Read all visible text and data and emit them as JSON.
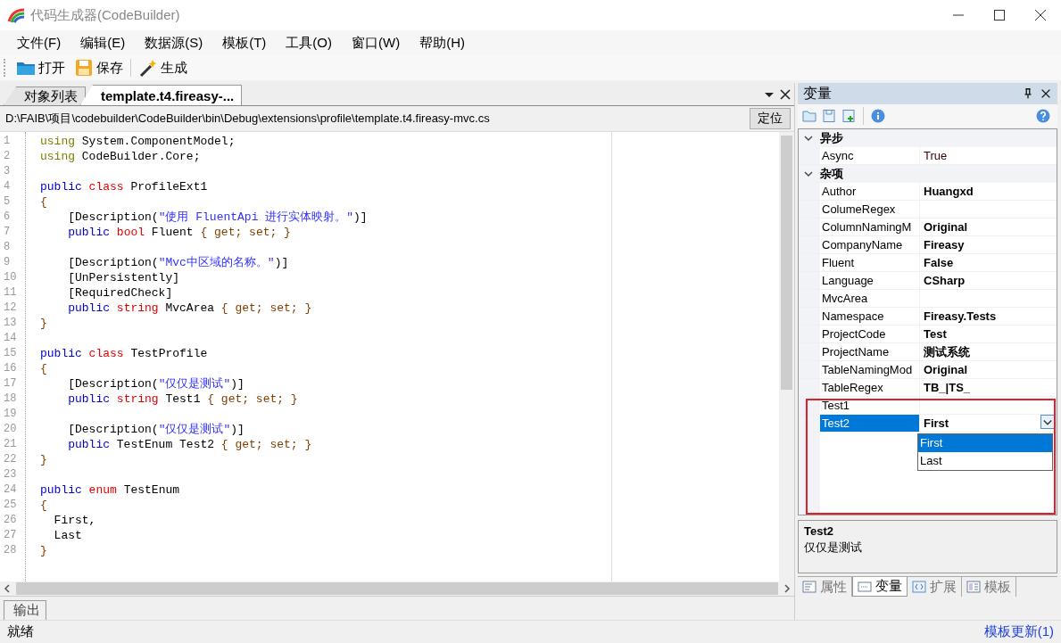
{
  "window": {
    "title": "代码生成器(CodeBuilder)"
  },
  "menu": [
    "文件(F)",
    "编辑(E)",
    "数据源(S)",
    "模板(T)",
    "工具(O)",
    "窗口(W)",
    "帮助(H)"
  ],
  "toolbar": [
    {
      "kind": "open",
      "label": "打开"
    },
    {
      "kind": "save",
      "label": "保存"
    },
    {
      "kind": "generate",
      "label": "生成"
    }
  ],
  "document_tabs": [
    {
      "label": "对象列表",
      "selected": false
    },
    {
      "label": "template.t4.fireasy-...",
      "selected": true
    }
  ],
  "path_bar": {
    "path": "D:\\FAIB\\项目\\codebuilder\\CodeBuilder\\bin\\Debug\\extensions\\profile\\template.t4.fireasy-mvc.cs",
    "button": "定位"
  },
  "editor": {
    "lines": [
      {
        "number": "1",
        "tokens": [
          {
            "kind": "directive",
            "text": "using"
          },
          {
            "kind": "plain",
            "text": " System.ComponentModel;"
          }
        ]
      },
      {
        "number": "2",
        "tokens": [
          {
            "kind": "directive",
            "text": "using"
          },
          {
            "kind": "plain",
            "text": " CodeBuilder.Core;"
          }
        ]
      },
      {
        "number": "3"
      },
      {
        "number": "4",
        "tokens": [
          {
            "kind": "keyword",
            "text": "public "
          },
          {
            "kind": "type",
            "text": "class"
          },
          {
            "kind": "plain",
            "text": " ProfileExt1"
          }
        ]
      },
      {
        "number": "5",
        "tokens": [
          {
            "kind": "brace",
            "text": "{"
          }
        ]
      },
      {
        "number": "6",
        "tokens": [
          {
            "kind": "plain",
            "text": "    [Description("
          },
          {
            "kind": "string",
            "text": "\"使用 FluentApi 进行实体映射。\""
          },
          {
            "kind": "plain",
            "text": ")]"
          }
        ]
      },
      {
        "number": "7",
        "tokens": [
          {
            "kind": "keyword",
            "text": "    public "
          },
          {
            "kind": "type",
            "text": "bool"
          },
          {
            "kind": "plain",
            "text": " Fluent "
          },
          {
            "kind": "brace",
            "text": "{ get; set; }"
          }
        ]
      },
      {
        "number": "8"
      },
      {
        "number": "9",
        "tokens": [
          {
            "kind": "plain",
            "text": "    [Description("
          },
          {
            "kind": "string",
            "text": "\"Mvc中区域的名称。\""
          },
          {
            "kind": "plain",
            "text": ")]"
          }
        ]
      },
      {
        "number": "10",
        "tokens": [
          {
            "kind": "plain",
            "text": "    [UnPersistently]"
          }
        ]
      },
      {
        "number": "11",
        "tokens": [
          {
            "kind": "plain",
            "text": "    [RequiredCheck]"
          }
        ]
      },
      {
        "number": "12",
        "tokens": [
          {
            "kind": "keyword",
            "text": "    public "
          },
          {
            "kind": "type",
            "text": "string"
          },
          {
            "kind": "plain",
            "text": " MvcArea "
          },
          {
            "kind": "brace",
            "text": "{ get; set; }"
          }
        ]
      },
      {
        "number": "13",
        "tokens": [
          {
            "kind": "brace",
            "text": "}"
          }
        ]
      },
      {
        "number": "14"
      },
      {
        "number": "15",
        "tokens": [
          {
            "kind": "keyword",
            "text": "public "
          },
          {
            "kind": "type",
            "text": "class"
          },
          {
            "kind": "plain",
            "text": " TestProfile"
          }
        ]
      },
      {
        "number": "16",
        "tokens": [
          {
            "kind": "brace",
            "text": "{"
          }
        ]
      },
      {
        "number": "17",
        "tokens": [
          {
            "kind": "plain",
            "text": "    [Description("
          },
          {
            "kind": "string",
            "text": "\"仅仅是测试\""
          },
          {
            "kind": "plain",
            "text": ")]"
          }
        ]
      },
      {
        "number": "18",
        "tokens": [
          {
            "kind": "keyword",
            "text": "    public "
          },
          {
            "kind": "type",
            "text": "string"
          },
          {
            "kind": "plain",
            "text": " Test1 "
          },
          {
            "kind": "brace",
            "text": "{ get; set; }"
          }
        ]
      },
      {
        "number": "19"
      },
      {
        "number": "20",
        "tokens": [
          {
            "kind": "plain",
            "text": "    [Description("
          },
          {
            "kind": "string",
            "text": "\"仅仅是测试\""
          },
          {
            "kind": "plain",
            "text": ")]"
          }
        ]
      },
      {
        "number": "21",
        "tokens": [
          {
            "kind": "keyword",
            "text": "    public"
          },
          {
            "kind": "plain",
            "text": " TestEnum Test2 "
          },
          {
            "kind": "brace",
            "text": "{ get; set; }"
          }
        ]
      },
      {
        "number": "22",
        "tokens": [
          {
            "kind": "brace",
            "text": "}"
          }
        ]
      },
      {
        "number": "23"
      },
      {
        "number": "24",
        "tokens": [
          {
            "kind": "keyword",
            "text": "public "
          },
          {
            "kind": "type",
            "text": "enum"
          },
          {
            "kind": "plain",
            "text": " TestEnum"
          }
        ]
      },
      {
        "number": "25",
        "tokens": [
          {
            "kind": "brace",
            "text": "{"
          }
        ]
      },
      {
        "number": "26",
        "tokens": [
          {
            "kind": "plain",
            "text": "  First,"
          }
        ]
      },
      {
        "number": "27",
        "tokens": [
          {
            "kind": "plain",
            "text": "  Last"
          }
        ]
      },
      {
        "number": "28",
        "tokens": [
          {
            "kind": "brace",
            "text": "}"
          }
        ]
      }
    ]
  },
  "output_tab": {
    "label": "输出"
  },
  "status_bar": {
    "text": "就绪",
    "link": "模板更新(1)"
  },
  "variables_panel": {
    "title": "变量",
    "categories": [
      {
        "name": "异步",
        "expanded": true,
        "properties": [
          {
            "name": "Async",
            "value": "True",
            "modified": false,
            "selected": false
          }
        ]
      },
      {
        "name": "杂项",
        "expanded": true,
        "properties": [
          {
            "name": "Author",
            "value": "Huangxd",
            "modified": true,
            "selected": false
          },
          {
            "name": "ColumeRegex",
            "selected": false
          },
          {
            "name": "ColumnNamingM",
            "value": "Original",
            "modified": true,
            "selected": false
          },
          {
            "name": "CompanyName",
            "value": "Fireasy",
            "modified": true,
            "selected": false
          },
          {
            "name": "Fluent",
            "value": "False",
            "modified": true,
            "selected": false
          },
          {
            "name": "Language",
            "value": "CSharp",
            "modified": true,
            "selected": false
          },
          {
            "name": "MvcArea",
            "selected": false
          },
          {
            "name": "Namespace",
            "value": "Fireasy.Tests",
            "modified": true,
            "selected": false
          },
          {
            "name": "ProjectCode",
            "value": "Test",
            "modified": true,
            "selected": false
          },
          {
            "name": "ProjectName",
            "value": "测试系统",
            "modified": true,
            "selected": false
          },
          {
            "name": "TableNamingMod",
            "value": "Original",
            "modified": true,
            "selected": false
          },
          {
            "name": "TableRegex",
            "value": "TB_|TS_",
            "modified": true,
            "selected": false
          },
          {
            "name": "Test1",
            "selected": false
          },
          {
            "name": "Test2",
            "value": "First",
            "modified": true,
            "selected": true
          }
        ]
      }
    ],
    "dropdown": {
      "options": [
        {
          "label": "First",
          "selected": true
        },
        {
          "label": "Last",
          "selected": false
        }
      ]
    },
    "description": {
      "title": "Test2",
      "text": "仅仅是测试"
    },
    "tabs": [
      {
        "kind": "properties",
        "label": "属性",
        "selected": false
      },
      {
        "kind": "variables",
        "label": "变量",
        "selected": true
      },
      {
        "kind": "extensions",
        "label": "扩展",
        "selected": false
      },
      {
        "kind": "templates",
        "label": "模板",
        "selected": false
      }
    ]
  }
}
